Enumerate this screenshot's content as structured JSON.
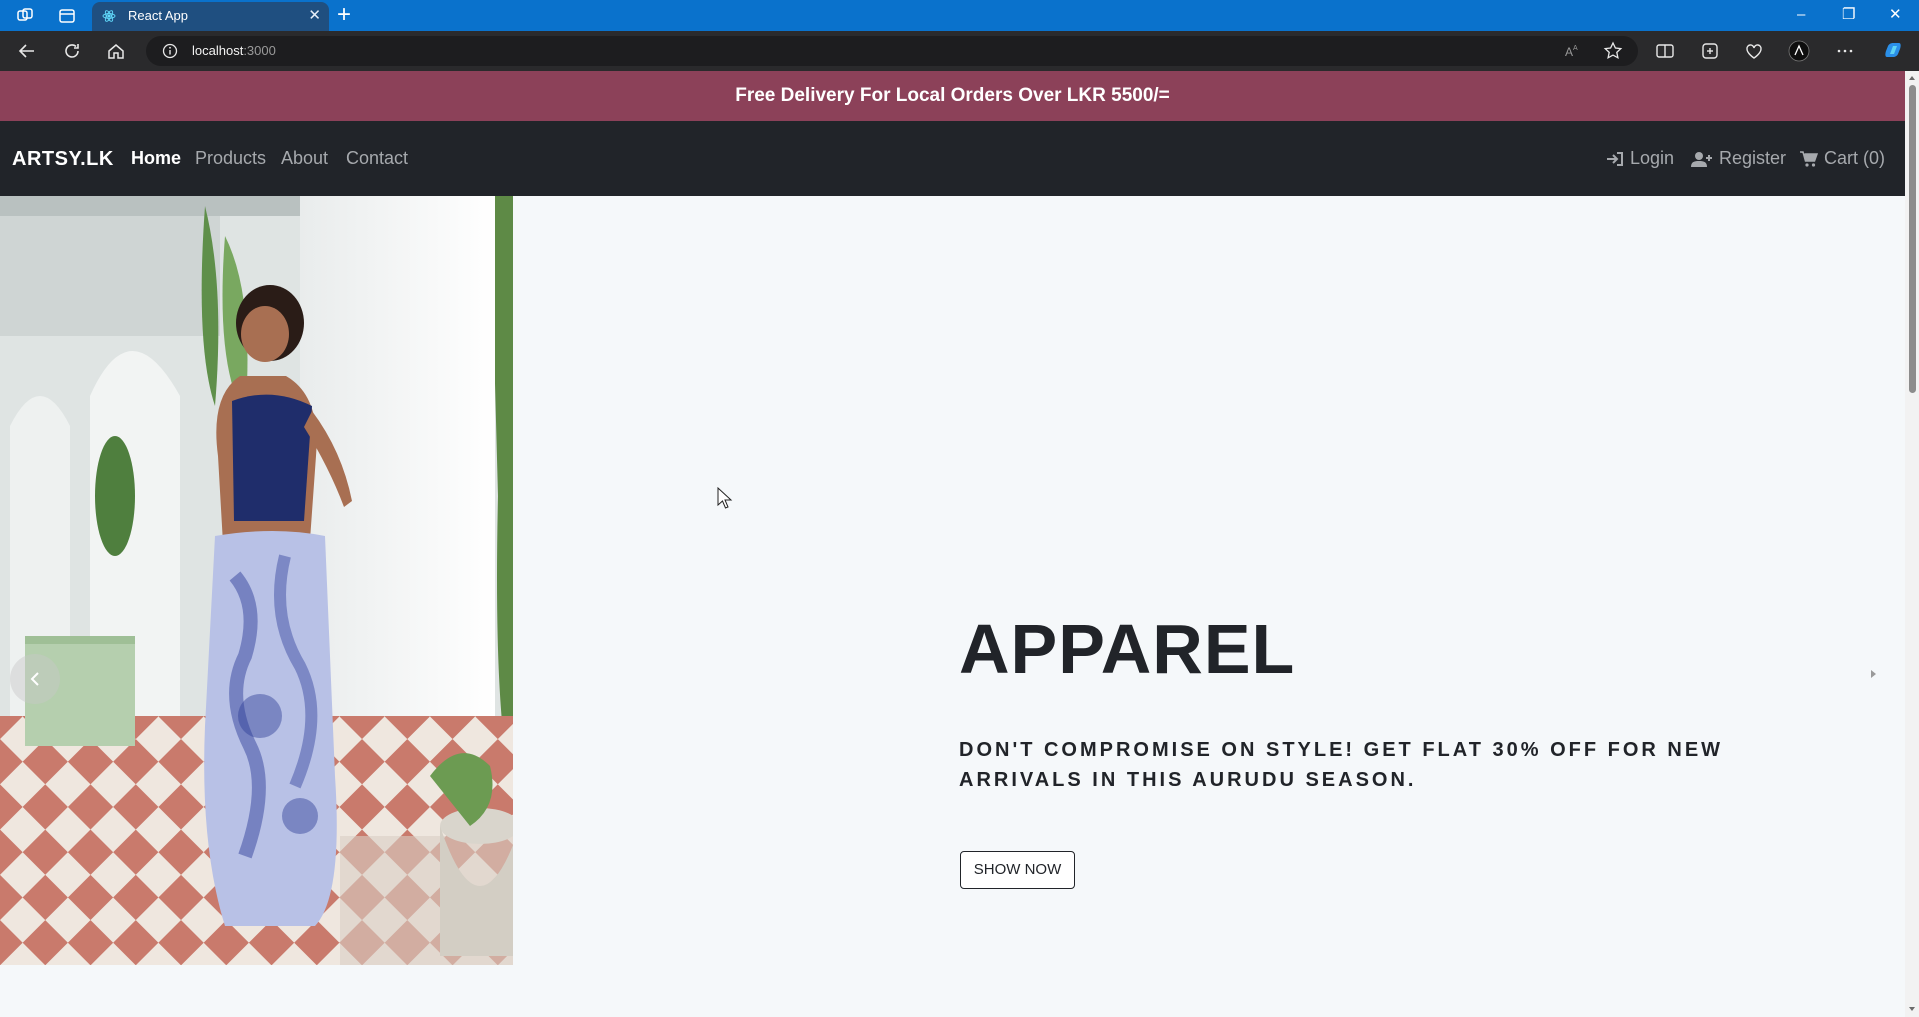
{
  "browser": {
    "tab_title": "React App",
    "new_tab": "+",
    "close_tab": "✕",
    "address_host": "localhost",
    "address_port": ":3000",
    "window_controls": [
      "–",
      "❐",
      "✕"
    ]
  },
  "announcement": "Free Delivery For Local Orders Over LKR 5500/=",
  "navbar": {
    "brand": "ARTSY.LK",
    "links": [
      "Home",
      "Products",
      "About",
      "Contact"
    ],
    "active": "Home",
    "right": [
      {
        "label": "Login",
        "icon": "sign-in-icon"
      },
      {
        "label": "Register",
        "icon": "user-plus-icon"
      },
      {
        "label": "Cart (0)",
        "icon": "cart-icon"
      }
    ]
  },
  "hero": {
    "title": "APPAREL",
    "subtitle": "DON'T COMPROMISE ON STYLE! GET FLAT 30% OFF FOR NEW ARRIVALS IN THIS AURUDU SEASON.",
    "button": "SHOW NOW",
    "image": "model-in-tie-dye-skirt-photo"
  },
  "colors": {
    "announcement_bg": "#8c4159",
    "navbar_bg": "#212429",
    "page_bg": "#f5f8fa",
    "tabstrip_bg": "#0a72cc"
  }
}
